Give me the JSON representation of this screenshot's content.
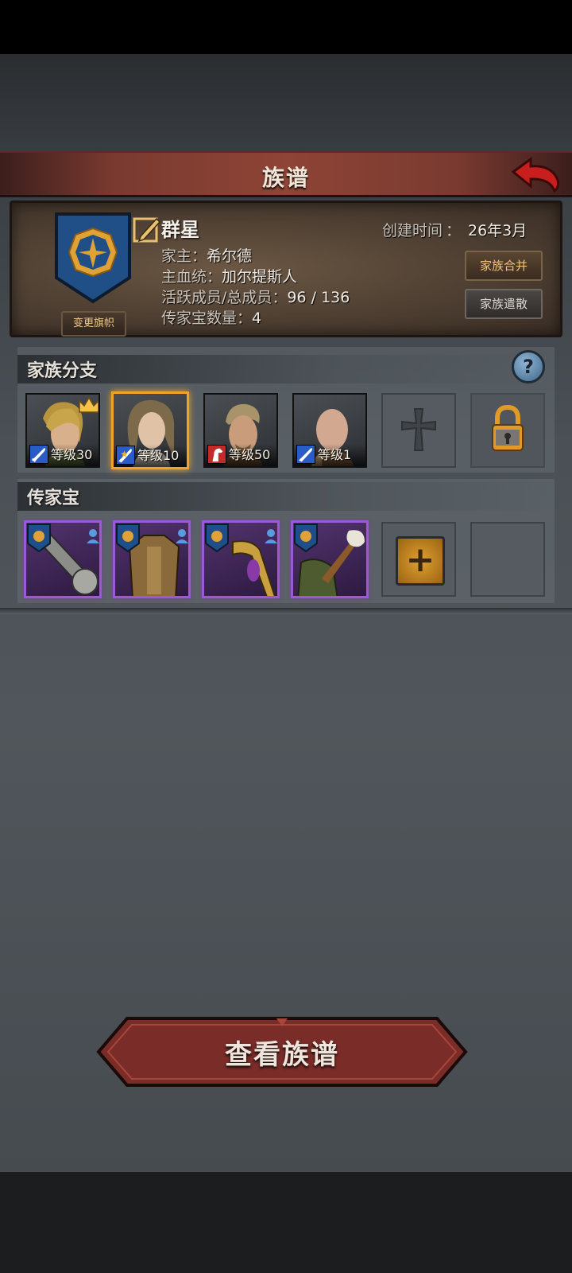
{
  "header": {
    "title": "族谱"
  },
  "family": {
    "name": "群星",
    "created_label": "创建时间",
    "created_sep": "：",
    "created_value": "26年3月",
    "head_label": "家主：",
    "head_value": "希尔德",
    "bloodline_label": "主血统：",
    "bloodline_value": "加尔提斯人",
    "members_label": "活跃成员/总成员：",
    "members_value": "96 / 136",
    "heirlooms_label": "传家宝数量：",
    "heirlooms_value": "4",
    "change_banner_label": "变更旗帜",
    "merge_label": "家族合并",
    "disband_label": "家族遣散"
  },
  "branches": {
    "title": "家族分支",
    "help_label": "?",
    "members": [
      {
        "level": "等级30",
        "class": "sword",
        "leader": true,
        "selected": false
      },
      {
        "level": "等级10",
        "class": "sword",
        "leader": false,
        "selected": true
      },
      {
        "level": "等级50",
        "class": "horse",
        "leader": false,
        "selected": false
      },
      {
        "level": "等级1",
        "class": "sword",
        "leader": false,
        "selected": false
      }
    ]
  },
  "heirlooms": {
    "title": "传家宝",
    "items": [
      "mace",
      "armor",
      "scepter",
      "torch"
    ],
    "add_label": "+"
  },
  "view_button": {
    "label": "查看族谱"
  },
  "colors": {
    "accent_red": "#7a3a30",
    "gold": "#f0a22a",
    "purple_rarity": "#9d58d4"
  }
}
